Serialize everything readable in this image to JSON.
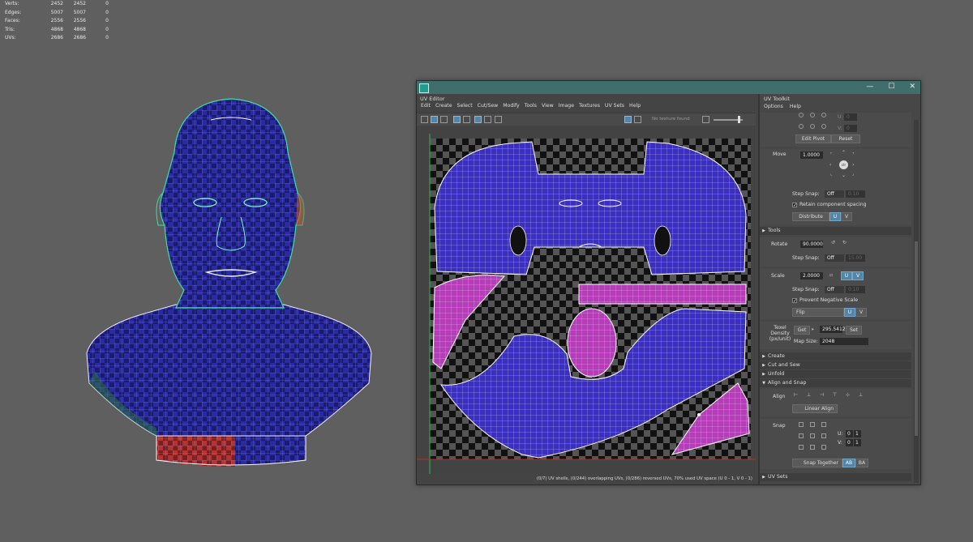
{
  "stats": [
    {
      "label": "Verts:",
      "a": "2452",
      "b": "2452",
      "c": "0"
    },
    {
      "label": "Edges:",
      "a": "5007",
      "b": "5007",
      "c": "0"
    },
    {
      "label": "Faces:",
      "a": "2556",
      "b": "2556",
      "c": "0"
    },
    {
      "label": "Tris:",
      "a": "4868",
      "b": "4868",
      "c": "0"
    },
    {
      "label": "UVs:",
      "a": "2686",
      "b": "2686",
      "c": "0"
    }
  ],
  "window": {
    "buttons": {
      "minimize": "—",
      "maximize": "☐",
      "close": "✕"
    }
  },
  "uv_editor": {
    "title": "UV Editor",
    "menu": [
      "Edit",
      "Create",
      "Select",
      "Cut/Sew",
      "Modify",
      "Tools",
      "View",
      "Image",
      "Textures",
      "UV Sets",
      "Help"
    ],
    "texture_label": "No texture found",
    "status": "(0/7) UV shells, (0/244) overlapping UVs, (0/286) reversed UVs, 70% used UV space (U 0 - 1, V 0 - 1)"
  },
  "uv_toolkit": {
    "title": "UV Toolkit",
    "menu": [
      "Options",
      "Help"
    ],
    "pivot": {
      "u_label": "U:",
      "v_label": "V:",
      "u_value": "0",
      "v_value": "0",
      "edit_pivot": "Edit Pivot",
      "reset": "Reset"
    },
    "move": {
      "label": "Move",
      "value": "1.0000",
      "center": "ctr",
      "step_snap_label": "Step Snap:",
      "step_snap_value": "Off",
      "step_snap_amount": "0.10",
      "retain": "Retain component spacing",
      "distribute": "Distribute",
      "u": "U",
      "v": "V"
    },
    "tools_section": "Tools",
    "rotate": {
      "label": "Rotate",
      "value": "90.0000",
      "step_snap_label": "Step Snap:",
      "step_snap_value": "Off",
      "step_snap_amount": "15.00"
    },
    "scale": {
      "label": "Scale",
      "value": "2.0000",
      "u": "U",
      "v": "V",
      "step_snap_label": "Step Snap:",
      "step_snap_value": "Off",
      "step_snap_amount": "0.10",
      "prevent": "Prevent Negative Scale",
      "flip": "Flip"
    },
    "texel": {
      "label": "Texel Density (px/unit)",
      "get": "Get",
      "value": "295.5412",
      "set": "Set",
      "map_size_label": "Map Size:",
      "map_size": "2048"
    },
    "sections": [
      "Create",
      "Cut and Sew",
      "Unfold",
      "Align and Snap"
    ],
    "align": {
      "label": "Align",
      "linear_align": "Linear Align"
    },
    "snap": {
      "label": "Snap",
      "u_label": "U:",
      "v_label": "V:",
      "u0": "0",
      "u1": "1",
      "v0": "0",
      "v1": "1",
      "snap_together": "Snap Together",
      "ab": "AB",
      "ba": "BA"
    },
    "uv_sets": "UV Sets"
  },
  "colors": {
    "accent": "#5285a6",
    "titlebar": "#3f6e6c",
    "shell_blue": "#3a2fbf",
    "shell_magenta": "#b63cb8",
    "shell_red": "#b83232"
  }
}
